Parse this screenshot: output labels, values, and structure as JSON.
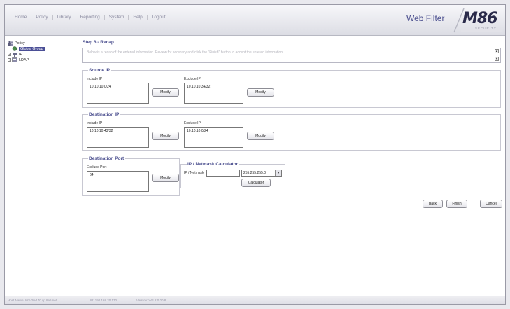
{
  "header": {
    "menu": [
      "Home",
      "Policy",
      "Library",
      "Reporting",
      "System",
      "Help",
      "Logout"
    ],
    "product_title": "Web Filter",
    "logo_main": "M86",
    "logo_sub": "SECURITY"
  },
  "sidebar": {
    "root": "Policy",
    "children": [
      "Global Group",
      "IP",
      "LDAP"
    ]
  },
  "main": {
    "step_title": "Step 6 - Recap",
    "recap_text": "Below is a recap of the entered information. Review for accuracy and click the \"Finish\" button to accept the entered information.",
    "source_ip": {
      "title": "Source IP",
      "include_label": "Include IP",
      "include_value": "10.10.10.0/24",
      "exclude_label": "Exclude IP",
      "exclude_value": "10.10.10.34/32",
      "modify_label": "Modify"
    },
    "destination_ip": {
      "title": "Destination IP",
      "include_label": "Include IP",
      "include_value": "10.10.10.43/32",
      "exclude_label": "Exclude IP",
      "exclude_value": "10.10.10.0/24",
      "modify_label": "Modify"
    },
    "destination_port": {
      "title": "Destination Port",
      "exclude_label": "Exclude Port",
      "exclude_value": "64",
      "modify_label": "Modify"
    },
    "calculator": {
      "title": "IP / Netmask Calculator",
      "ip_label": "IP / Netmask",
      "ip_value": "",
      "netmask_value": "255.255.255.0",
      "button_label": "Calculator"
    },
    "actions": {
      "back": "Back",
      "finish": "Finish",
      "cancel": "Cancel"
    }
  },
  "status": {
    "host": "Host Name: WS-20-170.sp.8e6.net",
    "ip": "IP: 192.168.20.170",
    "version": "Version: WS 2.0.00.8"
  }
}
